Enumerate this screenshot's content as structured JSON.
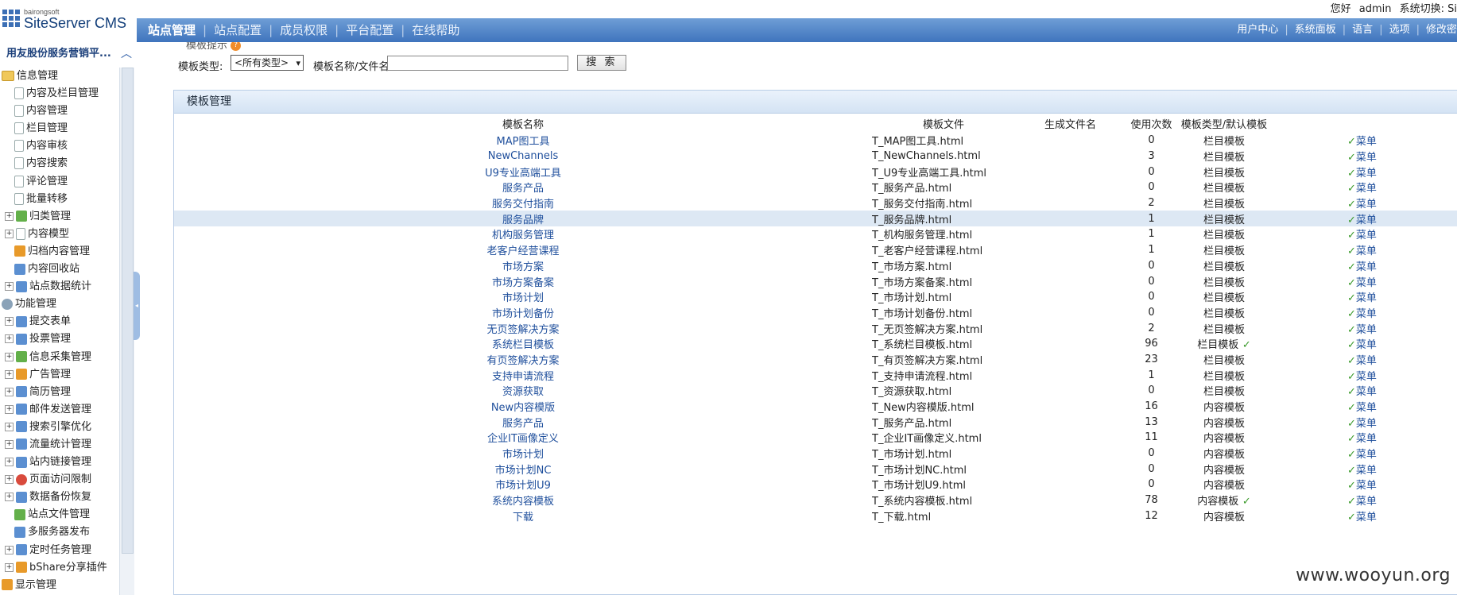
{
  "header": {
    "logo_small": "bairongsoft",
    "logo_title": "SiteServer CMS",
    "greeting": "您好",
    "username": "admin",
    "system_switch": "系统切换: Si"
  },
  "topnav": [
    {
      "label": "站点管理",
      "active": true
    },
    {
      "label": "站点配置"
    },
    {
      "label": "成员权限"
    },
    {
      "label": "平台配置"
    },
    {
      "label": "在线帮助"
    }
  ],
  "rightnav": [
    "用户中心",
    "系统面板",
    "语言",
    "选项",
    "修改密"
  ],
  "sidebar": {
    "site_title": "用友股份服务营销平...",
    "items": [
      {
        "label": "信息管理",
        "indent": 0,
        "exp": "",
        "icon": "folder"
      },
      {
        "label": "内容及栏目管理",
        "indent": 2,
        "exp": "",
        "icon": "doc"
      },
      {
        "label": "内容管理",
        "indent": 2,
        "exp": "",
        "icon": "doc"
      },
      {
        "label": "栏目管理",
        "indent": 2,
        "exp": "",
        "icon": "doc"
      },
      {
        "label": "内容审核",
        "indent": 2,
        "exp": "",
        "icon": "doc"
      },
      {
        "label": "内容搜索",
        "indent": 2,
        "exp": "",
        "icon": "doc"
      },
      {
        "label": "评论管理",
        "indent": 2,
        "exp": "",
        "icon": "doc"
      },
      {
        "label": "批量转移",
        "indent": 2,
        "exp": "",
        "icon": "doc"
      },
      {
        "label": "归类管理",
        "indent": 1,
        "exp": "+",
        "icon": "green"
      },
      {
        "label": "内容模型",
        "indent": 1,
        "exp": "+",
        "icon": "doc"
      },
      {
        "label": "归档内容管理",
        "indent": 2,
        "exp": "",
        "icon": "orange"
      },
      {
        "label": "内容回收站",
        "indent": 2,
        "exp": "",
        "icon": "blue"
      },
      {
        "label": "站点数据统计",
        "indent": 1,
        "exp": "+",
        "icon": "blue"
      },
      {
        "label": "功能管理",
        "indent": 0,
        "exp": "",
        "icon": "tool"
      },
      {
        "label": "提交表单",
        "indent": 1,
        "exp": "+",
        "icon": "blue"
      },
      {
        "label": "投票管理",
        "indent": 1,
        "exp": "+",
        "icon": "blue"
      },
      {
        "label": "信息采集管理",
        "indent": 1,
        "exp": "+",
        "icon": "green"
      },
      {
        "label": "广告管理",
        "indent": 1,
        "exp": "+",
        "icon": "orange"
      },
      {
        "label": "简历管理",
        "indent": 1,
        "exp": "+",
        "icon": "blue"
      },
      {
        "label": "邮件发送管理",
        "indent": 1,
        "exp": "+",
        "icon": "blue"
      },
      {
        "label": "搜索引擎优化",
        "indent": 1,
        "exp": "+",
        "icon": "blue"
      },
      {
        "label": "流量统计管理",
        "indent": 1,
        "exp": "+",
        "icon": "blue"
      },
      {
        "label": "站内链接管理",
        "indent": 1,
        "exp": "+",
        "icon": "blue"
      },
      {
        "label": "页面访问限制",
        "indent": 1,
        "exp": "+",
        "icon": "red"
      },
      {
        "label": "数据备份恢复",
        "indent": 1,
        "exp": "+",
        "icon": "blue"
      },
      {
        "label": "站点文件管理",
        "indent": 2,
        "exp": "",
        "icon": "green"
      },
      {
        "label": "多服务器发布",
        "indent": 2,
        "exp": "",
        "icon": "blue"
      },
      {
        "label": "定时任务管理",
        "indent": 1,
        "exp": "+",
        "icon": "blue"
      },
      {
        "label": "bShare分享插件",
        "indent": 1,
        "exp": "+",
        "icon": "orange"
      },
      {
        "label": "显示管理",
        "indent": 0,
        "exp": "",
        "icon": "orange"
      }
    ]
  },
  "filter": {
    "tip_label": "模板提示",
    "type_label": "模板类型:",
    "type_value": "<所有类型>",
    "name_label": "模板名称/文件名:",
    "name_value": "",
    "search_label": "搜 索"
  },
  "panel": {
    "title": "模板管理",
    "columns": [
      "模板名称",
      "模板文件",
      "生成文件名",
      "使用次数",
      "模板类型/默认模板",
      ""
    ],
    "rows": [
      {
        "name": "MAP图工具",
        "file": "T_MAP图工具.html",
        "count": "0",
        "type": "栏目模板",
        "default": false,
        "action": "菜单"
      },
      {
        "name": "NewChannels",
        "file": "T_NewChannels.html",
        "count": "3",
        "type": "栏目模板",
        "default": false,
        "action": "菜单"
      },
      {
        "name": "U9专业高端工具",
        "file": "T_U9专业高端工具.html",
        "count": "0",
        "type": "栏目模板",
        "default": false,
        "action": "菜单"
      },
      {
        "name": "服务产品",
        "file": "T_服务产品.html",
        "count": "0",
        "type": "栏目模板",
        "default": false,
        "action": "菜单"
      },
      {
        "name": "服务交付指南",
        "file": "T_服务交付指南.html",
        "count": "2",
        "type": "栏目模板",
        "default": false,
        "action": "菜单"
      },
      {
        "name": "服务品牌",
        "file": "T_服务品牌.html",
        "count": "1",
        "type": "栏目模板",
        "default": false,
        "action": "菜单",
        "highlight": true
      },
      {
        "name": "机构服务管理",
        "file": "T_机构服务管理.html",
        "count": "1",
        "type": "栏目模板",
        "default": false,
        "action": "菜单"
      },
      {
        "name": "老客户经营课程",
        "file": "T_老客户经营课程.html",
        "count": "1",
        "type": "栏目模板",
        "default": false,
        "action": "菜单"
      },
      {
        "name": "市场方案",
        "file": "T_市场方案.html",
        "count": "0",
        "type": "栏目模板",
        "default": false,
        "action": "菜单"
      },
      {
        "name": "市场方案备案",
        "file": "T_市场方案备案.html",
        "count": "0",
        "type": "栏目模板",
        "default": false,
        "action": "菜单"
      },
      {
        "name": "市场计划",
        "file": "T_市场计划.html",
        "count": "0",
        "type": "栏目模板",
        "default": false,
        "action": "菜单"
      },
      {
        "name": "市场计划备份",
        "file": "T_市场计划备份.html",
        "count": "0",
        "type": "栏目模板",
        "default": false,
        "action": "菜单"
      },
      {
        "name": "无页签解决方案",
        "file": "T_无页签解决方案.html",
        "count": "2",
        "type": "栏目模板",
        "default": false,
        "action": "菜单"
      },
      {
        "name": "系统栏目模板",
        "file": "T_系统栏目模板.html",
        "count": "96",
        "type": "栏目模板",
        "default": true,
        "action": "菜单"
      },
      {
        "name": "有页签解决方案",
        "file": "T_有页签解决方案.html",
        "count": "23",
        "type": "栏目模板",
        "default": false,
        "action": "菜单"
      },
      {
        "name": "支持申请流程",
        "file": "T_支持申请流程.html",
        "count": "1",
        "type": "栏目模板",
        "default": false,
        "action": "菜单"
      },
      {
        "name": "资源获取",
        "file": "T_资源获取.html",
        "count": "0",
        "type": "栏目模板",
        "default": false,
        "action": "菜单"
      },
      {
        "name": "New内容模版",
        "file": "T_New内容模版.html",
        "count": "16",
        "type": "内容模板",
        "default": false,
        "action": "菜单"
      },
      {
        "name": "服务产品",
        "file": "T_服务产品.html",
        "count": "13",
        "type": "内容模板",
        "default": false,
        "action": "菜单"
      },
      {
        "name": "企业IT画像定义",
        "file": "T_企业IT画像定义.html",
        "count": "11",
        "type": "内容模板",
        "default": false,
        "action": "菜单"
      },
      {
        "name": "市场计划",
        "file": "T_市场计划.html",
        "count": "0",
        "type": "内容模板",
        "default": false,
        "action": "菜单"
      },
      {
        "name": "市场计划NC",
        "file": "T_市场计划NC.html",
        "count": "0",
        "type": "内容模板",
        "default": false,
        "action": "菜单"
      },
      {
        "name": "市场计划U9",
        "file": "T_市场计划U9.html",
        "count": "0",
        "type": "内容模板",
        "default": false,
        "action": "菜单"
      },
      {
        "name": "系统内容模板",
        "file": "T_系统内容模板.html",
        "count": "78",
        "type": "内容模板",
        "default": true,
        "action": "菜单"
      },
      {
        "name": "下载",
        "file": "T_下载.html",
        "count": "12",
        "type": "内容模板",
        "default": false,
        "action": "菜单"
      }
    ]
  },
  "watermark": "www.wooyun.org",
  "colors": {
    "nav_blue": "#3f74bd",
    "link_blue": "#1f4f9c",
    "check_green": "#3a9a2a",
    "highlight_row": "#dde8f4"
  }
}
